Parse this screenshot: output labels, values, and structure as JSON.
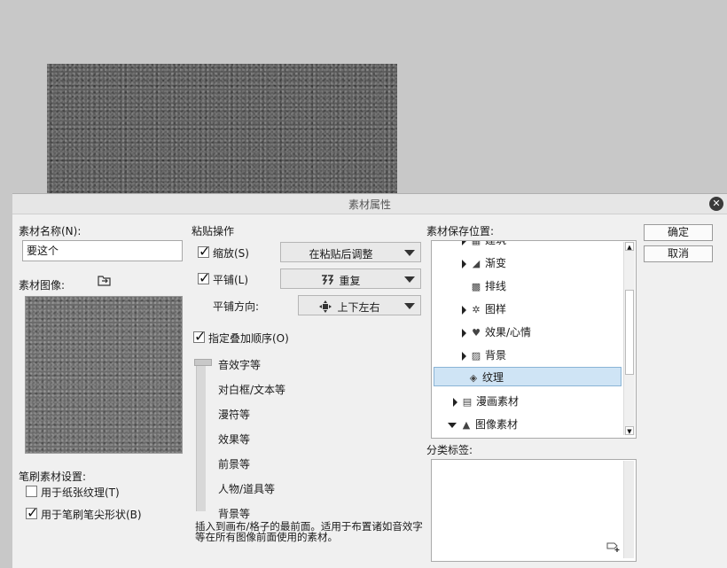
{
  "dialog": {
    "title": "素材属性",
    "close_icon": "close-icon"
  },
  "left": {
    "name_label": "素材名称(N):",
    "name_value": "要这个",
    "image_label": "素材图像:",
    "brush_settings_label": "笔刷素材设置:",
    "paper_texture_label": "用于纸张纹理(T)",
    "paper_texture_checked": false,
    "brush_tip_label": "用于笔刷笔尖形状(B)",
    "brush_tip_checked": true
  },
  "paste": {
    "section_label": "粘贴操作",
    "scale_label": "缩放(S)",
    "scale_checked": true,
    "scale_option": "在粘贴后调整",
    "tile_label": "平铺(L)",
    "tile_checked": true,
    "tile_option": "重复",
    "direction_label": "平铺方向:",
    "direction_option": "上下左右",
    "order_label": "指定叠加顺序(O)",
    "order_checked": true,
    "order_items": [
      "音效字等",
      "对白框/文本等",
      "漫符等",
      "效果等",
      "前景等",
      "人物/道具等",
      "背景等"
    ],
    "description": "插入到画布/格子的最前面。适用于布置诸如音效字等在所有图像前面使用的素材。"
  },
  "storage": {
    "label": "素材保存位置:",
    "items": [
      {
        "label": "建筑",
        "icon": "pattern-icon",
        "expanded": false
      },
      {
        "label": "渐变",
        "icon": "gradient-icon",
        "expanded": false
      },
      {
        "label": "排线",
        "icon": "hatching-icon",
        "expanded": null
      },
      {
        "label": "图样",
        "icon": "pattern-icon",
        "expanded": false
      },
      {
        "label": "效果/心情",
        "icon": "heart-icon",
        "expanded": false
      },
      {
        "label": "背景",
        "icon": "background-icon",
        "expanded": false
      },
      {
        "label": "纹理",
        "icon": "texture-icon",
        "selected": true
      },
      {
        "label": "漫画素材",
        "icon": "manga-icon",
        "expanded": false
      },
      {
        "label": "图像素材",
        "icon": "image-icon",
        "expanded": true
      }
    ],
    "tags_label": "分类标签:"
  },
  "buttons": {
    "ok": "确定",
    "cancel": "取消"
  }
}
